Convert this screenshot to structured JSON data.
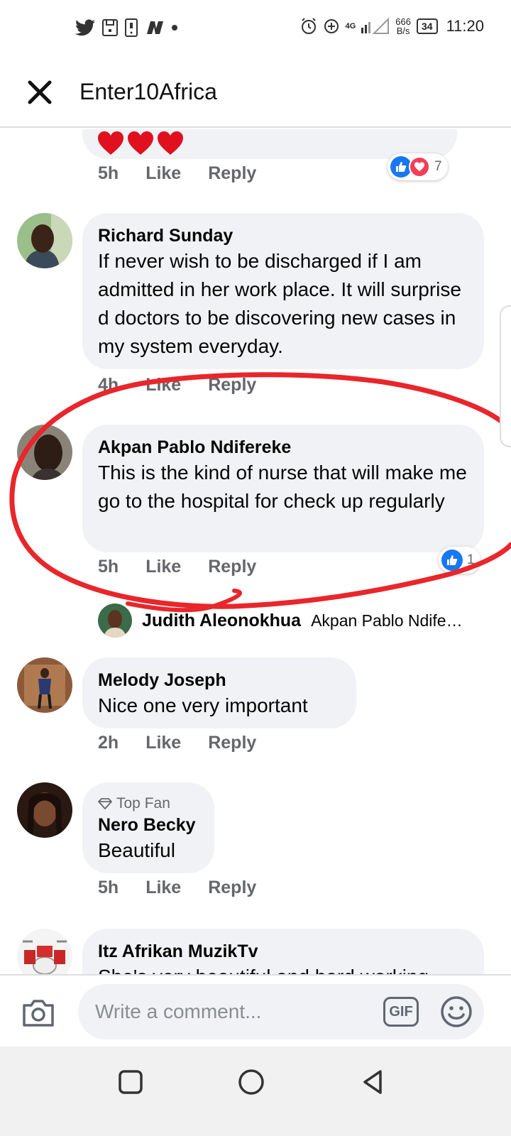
{
  "status_bar": {
    "network": "4G",
    "speed_value": "666",
    "speed_unit": "B/s",
    "battery": "34",
    "time": "11:20"
  },
  "header": {
    "title": "Enter10Africa"
  },
  "comments": [
    {
      "time": "5h",
      "like_label": "Like",
      "reply_label": "Reply",
      "reaction_count": "7"
    },
    {
      "author": "Richard Sunday",
      "text": "If never wish to be discharged if I am admitted in her work place. It will surprise d doctors to be discovering new cases in my system everyday.",
      "time": "4h",
      "like_label": "Like",
      "reply_label": "Reply"
    },
    {
      "author": "Akpan Pablo Ndifereke",
      "text": "This is the kind of nurse that will make me go to the hospital for check up regularly",
      "time": "5h",
      "like_label": "Like",
      "reply_label": "Reply",
      "reaction_count": "1",
      "reply_preview": {
        "author": "Judith Aleonokhua",
        "text": "Akpan Pablo Ndife…"
      }
    },
    {
      "author": "Melody Joseph",
      "text": "Nice one very important",
      "time": "2h",
      "like_label": "Like",
      "reply_label": "Reply"
    },
    {
      "badge": "Top Fan",
      "author": "Nero Becky",
      "text": "Beautiful",
      "time": "5h",
      "like_label": "Like",
      "reply_label": "Reply"
    },
    {
      "author": "Itz Afrikan MuzikTv",
      "text": "She's very beautiful and hard working"
    }
  ],
  "composer": {
    "placeholder": "Write a comment...",
    "gif_label": "GIF"
  },
  "colors": {
    "highlight_circle": "#e8262b",
    "like_blue": "#1877f2",
    "love_red": "#f33e58",
    "bubble_bg": "#f0f2f5"
  }
}
